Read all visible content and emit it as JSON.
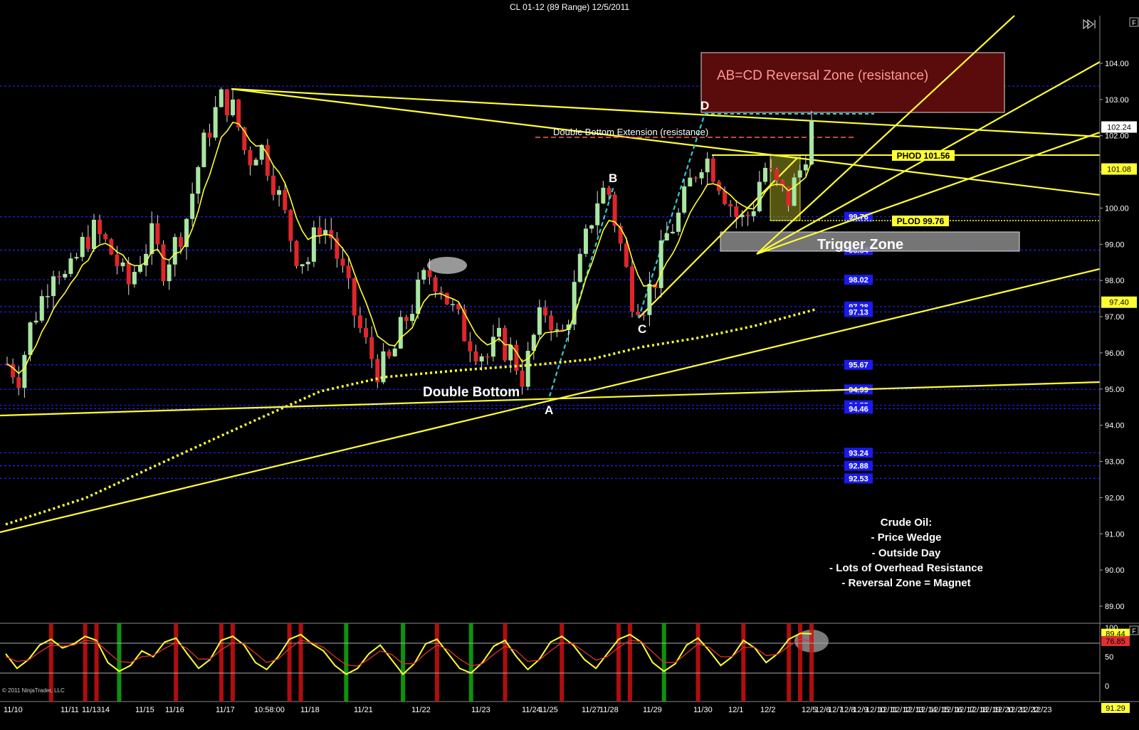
{
  "window": {
    "title": "CL 01-12 (89 Range)  12/5/2011",
    "copyright": "© 2011 NinjaTrader, LLC",
    "panel_button": "F",
    "indicator_panel_button": "F"
  },
  "colors": {
    "background": "#000000",
    "up_candle": "#a8e6a1",
    "down_candle": "#e0262a",
    "trendline": "#ffff33",
    "ema": "#ffff33",
    "level_line": "#1a1aff",
    "abcd_leg": "#33cccc",
    "reversal_zone_fill": "#5a0b0b",
    "trigger_zone_fill": "#7f7f7f"
  },
  "chart_data": [
    {
      "type": "candlestick",
      "title": "CL 01-12 (89 Range)  12/5/2011",
      "ylim": [
        89.0,
        104.5
      ],
      "y_ticks": [
        "104.00",
        "103.00",
        "102.00",
        "101.00",
        "100.00",
        "99.00",
        "98.00",
        "97.00",
        "96.00",
        "95.00",
        "94.00",
        "93.00",
        "92.00",
        "91.00",
        "90.00",
        "89.00"
      ],
      "x_ticks": [
        "11/10",
        "11/11",
        "11/1314",
        "11/15",
        "11/16",
        "11/17",
        "10:58:00",
        "11/18",
        "11/21",
        "11/22",
        "11/23",
        "11/24",
        "11/25",
        "11/27",
        "11/28",
        "11/29",
        "11/30",
        "12/1",
        "12/2",
        "12/5",
        "12/6",
        "12/7",
        "12/8",
        "12/9",
        "12/10",
        "12/11",
        "12/12",
        "12/13",
        "12/14",
        "12/15",
        "12/16",
        "12/17",
        "12/18",
        "12/19",
        "12/20",
        "12/21",
        "12/22",
        "12/23"
      ],
      "price_badges": [
        {
          "label": "102.24",
          "value": 102.24,
          "style": "white"
        },
        {
          "label": "101.08",
          "value": 101.08,
          "style": "yellow"
        },
        {
          "label": "97.40",
          "value": 97.4,
          "style": "yellow"
        }
      ],
      "levels": [
        {
          "label": "103.37",
          "value": 103.37
        },
        {
          "label": "99.76",
          "value": 99.76
        },
        {
          "label": "98.84",
          "value": 98.84
        },
        {
          "label": "98.02",
          "value": 98.02
        },
        {
          "label": "97.28",
          "value": 97.28
        },
        {
          "label": "97.13",
          "value": 97.13
        },
        {
          "label": "95.67",
          "value": 95.67
        },
        {
          "label": "94.99",
          "value": 94.99
        },
        {
          "label": "94.55",
          "value": 94.55
        },
        {
          "label": "94.46",
          "value": 94.46
        },
        {
          "label": "93.24",
          "value": 93.24
        },
        {
          "label": "92.88",
          "value": 92.88
        },
        {
          "label": "92.53",
          "value": 92.53
        }
      ],
      "annotations": {
        "reversal_zone": "AB=CD Reversal Zone (resistance)",
        "double_bottom_ext": "Double Bottom Extension (resistance)",
        "phod": "PHOD 101.56",
        "plod": "PLOD 99.76",
        "trigger_zone": "Trigger Zone",
        "double_bottom": "Double Bottom",
        "point_a": "A",
        "point_b": "B",
        "point_c": "C",
        "point_d": "D",
        "notes": [
          "Crude Oil:",
          "- Price Wedge",
          "- Outside Day",
          "- Lots of Overhead Resistance",
          "- Reversal Zone = Magnet"
        ]
      },
      "close_path": [
        95.7,
        95.4,
        96.8,
        97.6,
        98.6,
        97.9,
        98.8,
        99.4,
        99.1,
        98.6,
        97.8,
        98.6,
        99.2,
        98.4,
        99.0,
        99.8,
        101.3,
        102.4,
        103.1,
        102.6,
        101.3,
        101.8,
        101.0,
        99.9,
        98.8,
        98.5,
        99.6,
        99.2,
        98.1,
        97.0,
        96.1,
        95.5,
        95.8,
        96.8,
        97.5,
        98.2,
        98.0,
        97.2,
        96.6,
        96.2,
        95.9,
        96.3,
        96.0,
        95.3,
        96.6,
        97.3,
        96.2,
        97.4,
        98.8,
        100.2,
        100.6,
        99.1,
        97.6,
        97.4,
        98.1,
        99.3,
        99.8,
        100.8,
        101.5,
        101.0,
        100.3,
        99.6,
        99.9,
        101.2,
        100.6,
        100.2,
        101.0,
        102.24
      ]
    },
    {
      "type": "line",
      "title": "",
      "ylim": [
        0,
        100
      ],
      "y_ticks": [
        "100",
        "50",
        "0"
      ],
      "badges": [
        {
          "label": "89.44",
          "value": 89.44
        },
        {
          "label": "76.85",
          "value": 76.85
        },
        {
          "label": "91.29",
          "value": 91.29
        }
      ],
      "series": [
        {
          "values": [
            55,
            30,
            45,
            70,
            80,
            65,
            72,
            85,
            78,
            40,
            25,
            35,
            60,
            50,
            75,
            82,
            55,
            30,
            45,
            78,
            85,
            70,
            40,
            28,
            50,
            80,
            88,
            72,
            60,
            35,
            20,
            30,
            55,
            70,
            45,
            20,
            38,
            72,
            80,
            55,
            30,
            22,
            40,
            68,
            78,
            50,
            28,
            45,
            75,
            85,
            70,
            45,
            30,
            55,
            80,
            88,
            75,
            40,
            25,
            38,
            70,
            82,
            60,
            35,
            50,
            78,
            65,
            40,
            55,
            80,
            90,
            89.44
          ]
        },
        {
          "values": [
            50,
            42,
            44,
            58,
            70,
            68,
            70,
            78,
            76,
            58,
            42,
            40,
            50,
            52,
            64,
            74,
            64,
            46,
            46,
            62,
            74,
            72,
            56,
            40,
            46,
            64,
            78,
            74,
            66,
            50,
            36,
            34,
            46,
            60,
            54,
            38,
            38,
            56,
            70,
            62,
            46,
            34,
            38,
            54,
            68,
            60,
            42,
            44,
            60,
            74,
            72,
            58,
            44,
            50,
            66,
            78,
            76,
            58,
            40,
            40,
            56,
            72,
            66,
            50,
            50,
            66,
            66,
            52,
            54,
            68,
            80,
            76.85
          ]
        }
      ]
    }
  ]
}
